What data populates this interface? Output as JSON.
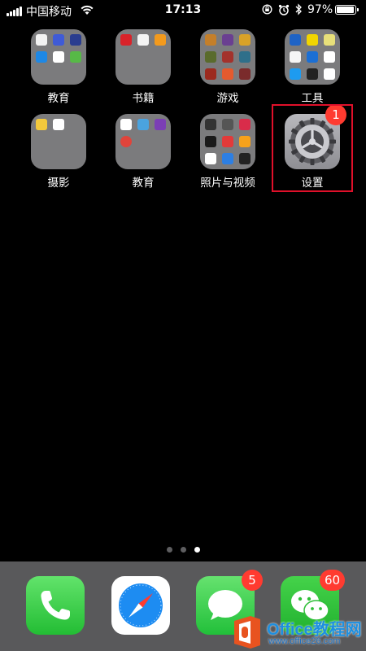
{
  "status_bar": {
    "carrier": "中国移动",
    "time": "17:13",
    "battery_text": "97%",
    "battery_level": 0.97,
    "icons": [
      "signal-icon",
      "wifi-icon",
      "rotation-lock-icon",
      "alarm-icon",
      "bluetooth-icon",
      "battery-icon"
    ]
  },
  "apps": [
    {
      "label": "教育",
      "kind": "folder"
    },
    {
      "label": "书籍",
      "kind": "folder"
    },
    {
      "label": "游戏",
      "kind": "folder"
    },
    {
      "label": "工具",
      "kind": "folder"
    },
    {
      "label": "摄影",
      "kind": "folder"
    },
    {
      "label": "教育",
      "kind": "folder"
    },
    {
      "label": "照片与视频",
      "kind": "folder"
    },
    {
      "label": "设置",
      "kind": "app",
      "icon": "gear-icon",
      "badge": "1",
      "highlighted": true
    }
  ],
  "page_indicator": {
    "pages": 3,
    "current": 3
  },
  "dock": [
    {
      "name": "phone",
      "icon": "phone-icon"
    },
    {
      "name": "safari",
      "icon": "compass-icon"
    },
    {
      "name": "messages",
      "icon": "message-bubble-icon",
      "badge": "5"
    },
    {
      "name": "wechat",
      "icon": "wechat-icon",
      "badge": "60"
    }
  ],
  "watermark": {
    "text": "Office教程网",
    "url": "www.office26.com"
  },
  "colors": {
    "badge": "#ff3b30",
    "highlight": "#e0102a",
    "folder": "#7b7b7d",
    "dock": "#59595b"
  }
}
